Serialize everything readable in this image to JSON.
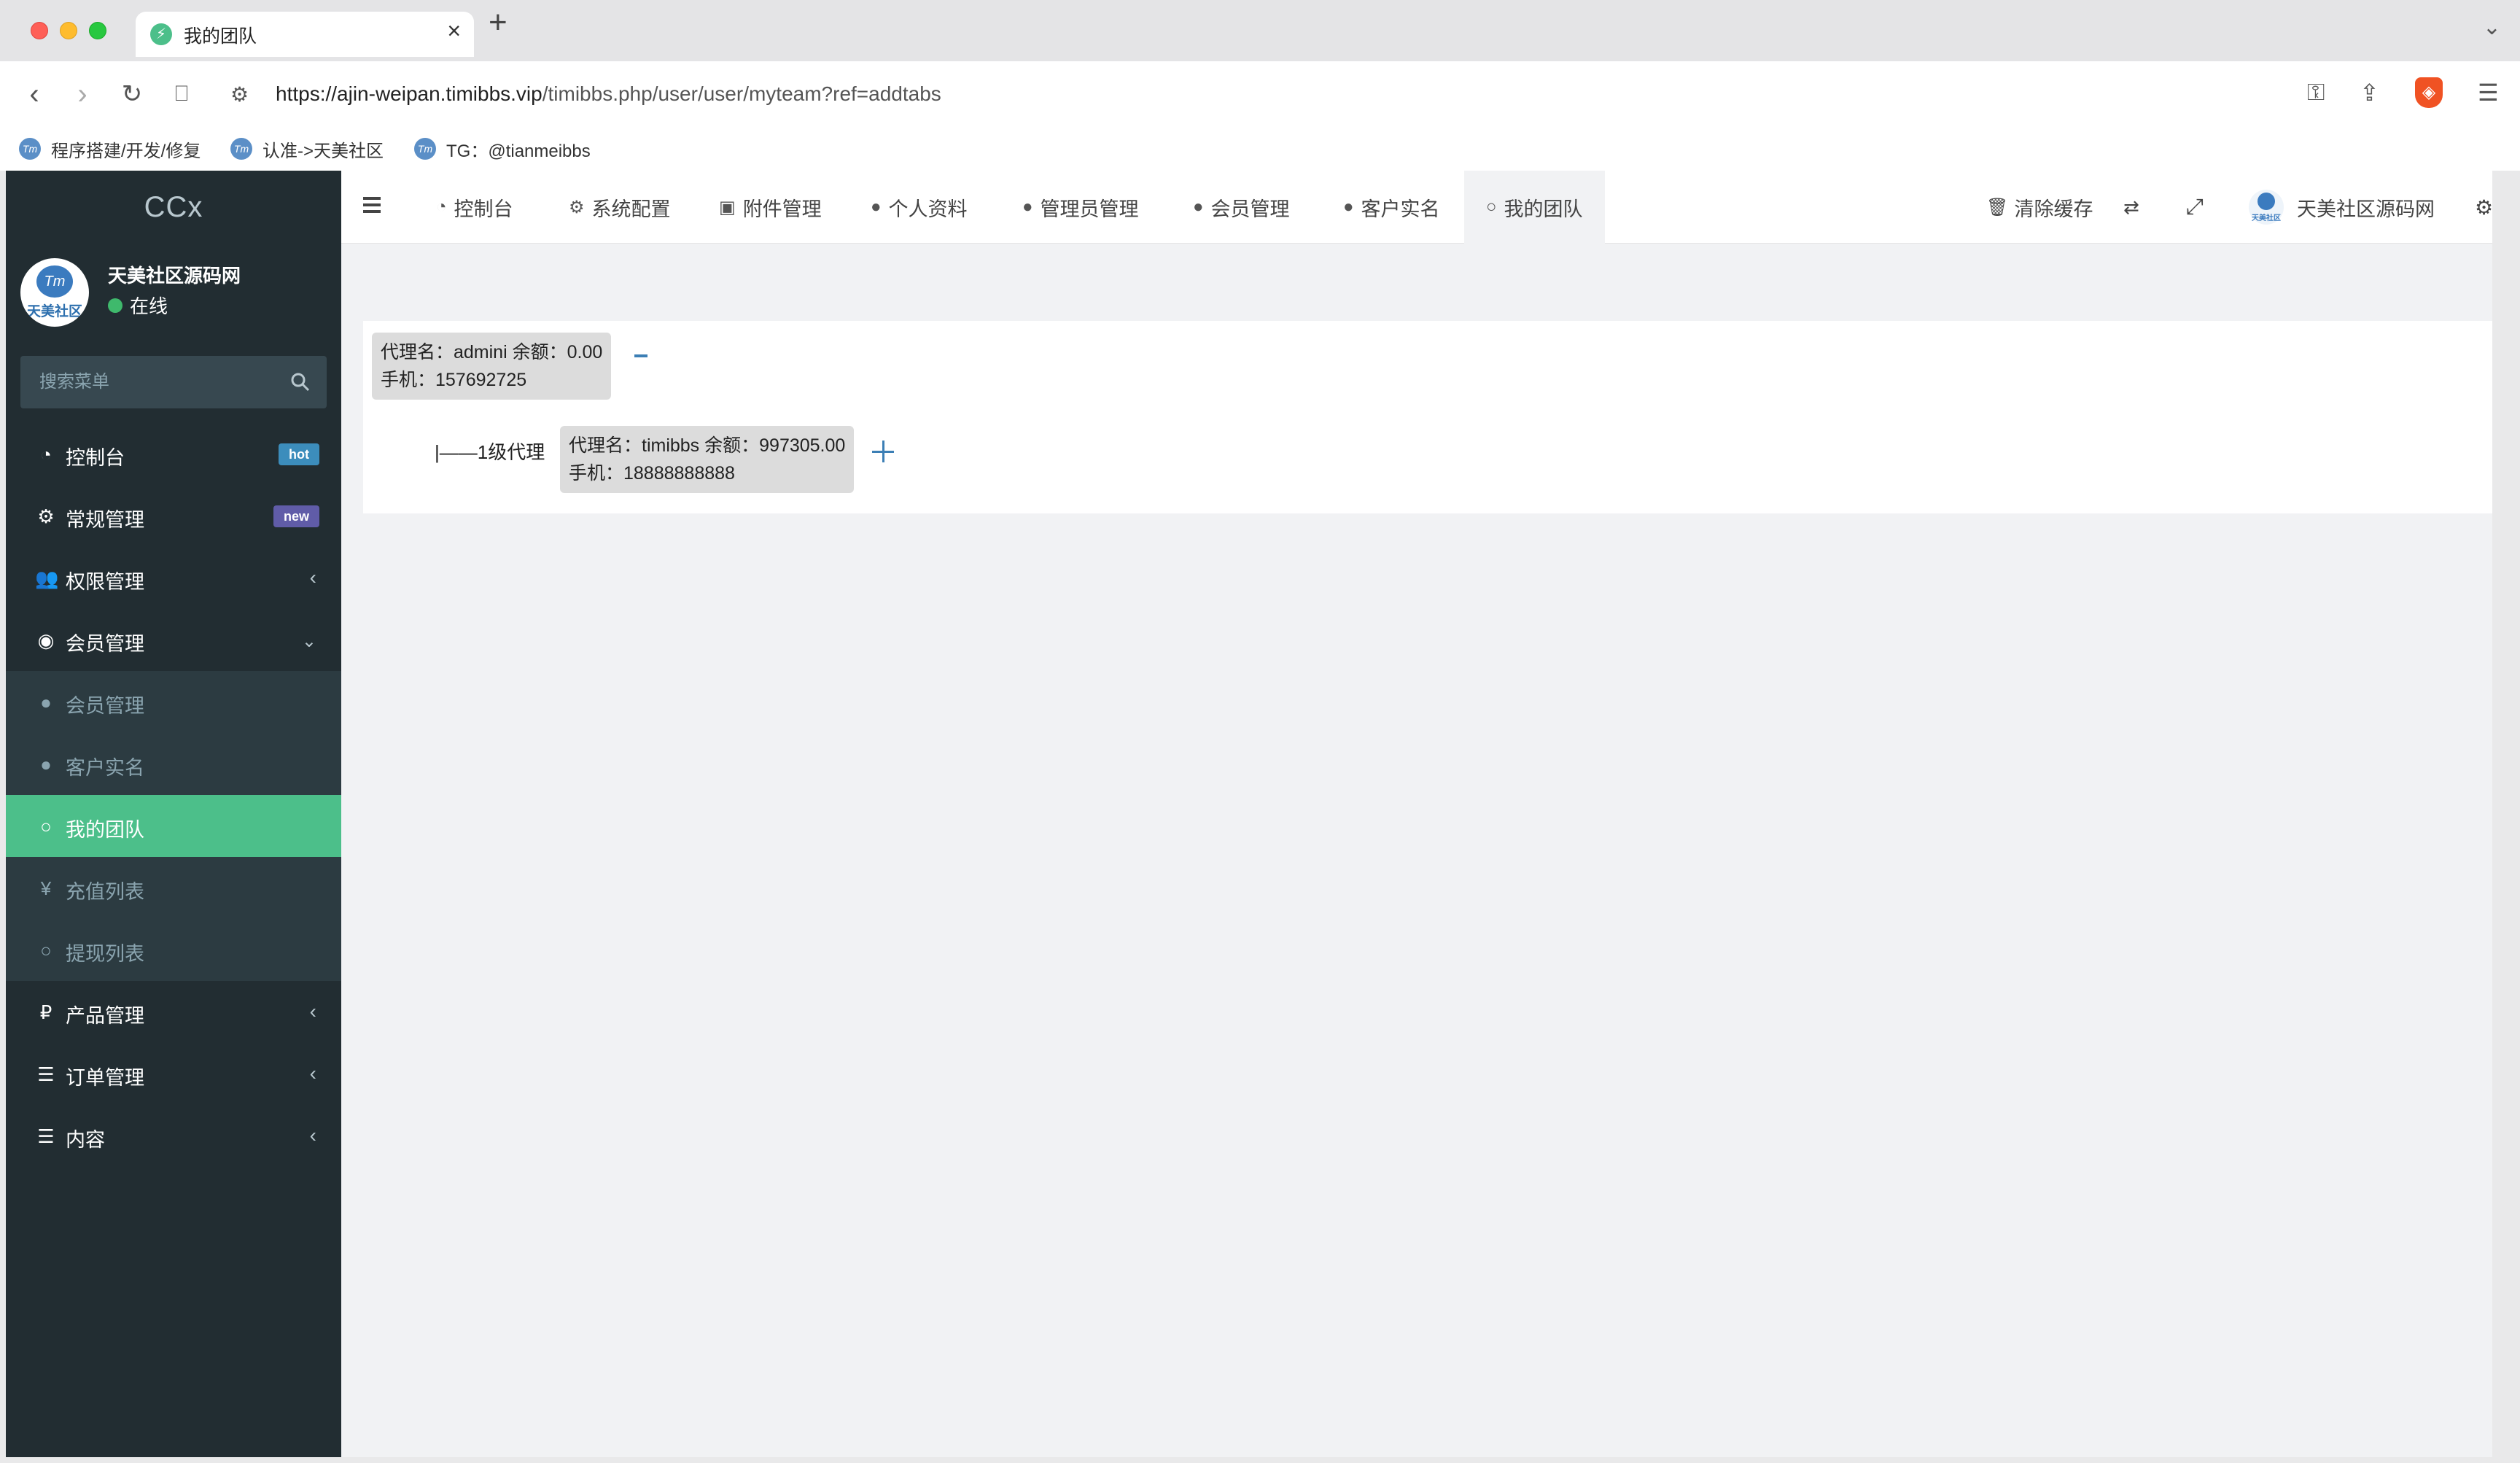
{
  "browser": {
    "tab_title": "我的团队",
    "tab_close": "×",
    "new_tab": "+",
    "url_host": "https://ajin-weipan.timibbs.vip",
    "url_path": "/timibbs.php/user/user/myteam?ref=addtabs",
    "bookmarks": [
      {
        "label": "程序搭建/开发/修复",
        "icon": "tm-logo-icon"
      },
      {
        "label": "认准->天美社区",
        "icon": "tm-logo-icon"
      },
      {
        "label": "TG：@tianmeibbs",
        "icon": "tm-logo-icon"
      }
    ]
  },
  "sidebar": {
    "logo": "CCx",
    "avatar_text": "天美社区",
    "user_name": "天美社区源码网",
    "status": "在线",
    "search_placeholder": "搜索菜单",
    "items": [
      {
        "label": "控制台",
        "icon": "dashboard-icon",
        "badge": "hot"
      },
      {
        "label": "常规管理",
        "icon": "cogs-icon",
        "badge": "new"
      },
      {
        "label": "权限管理",
        "icon": "users-icon"
      },
      {
        "label": "会员管理",
        "icon": "user-circle-icon"
      },
      {
        "label": "会员管理",
        "icon": "user-icon"
      },
      {
        "label": "客户实名",
        "icon": "user-icon"
      },
      {
        "label": "我的团队",
        "icon": "circle-icon"
      },
      {
        "label": "充值列表",
        "icon": "yen-icon"
      },
      {
        "label": "提现列表",
        "icon": "circle-icon"
      },
      {
        "label": "产品管理",
        "icon": "ruble-icon"
      },
      {
        "label": "订单管理",
        "icon": "list-icon"
      },
      {
        "label": "内容",
        "icon": "list-icon"
      }
    ]
  },
  "topnav": {
    "tabs": [
      {
        "label": "控制台",
        "icon": "dashboard-icon"
      },
      {
        "label": "系统配置",
        "icon": "gear-icon"
      },
      {
        "label": "附件管理",
        "icon": "image-icon"
      },
      {
        "label": "个人资料",
        "icon": "user-icon"
      },
      {
        "label": "管理员管理",
        "icon": "user-icon"
      },
      {
        "label": "会员管理",
        "icon": "user-icon"
      },
      {
        "label": "客户实名",
        "icon": "user-icon"
      },
      {
        "label": "我的团队",
        "icon": "circle-icon"
      }
    ],
    "clear_cache": "清除缓存",
    "site_name": "天美社区源码网",
    "brand_logo_text": "天美社区"
  },
  "team_tree": {
    "root": {
      "line1": "代理名：admini 余额：0.00",
      "line2": "手机：157692725"
    },
    "level_label": "|——1级代理",
    "child": {
      "line1": "代理名：timibbs 余额：997305.00",
      "line2": "手机：18888888888"
    }
  }
}
